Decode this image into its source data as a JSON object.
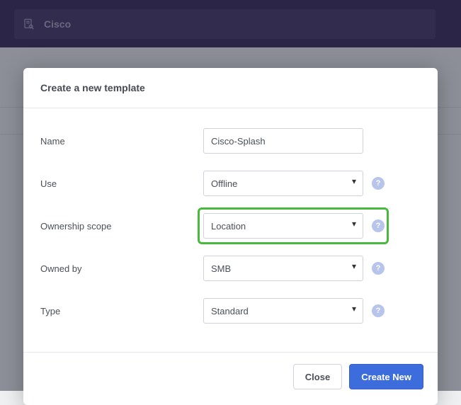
{
  "header": {
    "search_text": "Cisco"
  },
  "modal": {
    "title": "Create a new template",
    "fields": {
      "name": {
        "label": "Name",
        "value": "Cisco-Splash"
      },
      "use": {
        "label": "Use",
        "value": "Offline"
      },
      "ownership_scope": {
        "label": "Ownership scope",
        "value": "Location"
      },
      "owned_by": {
        "label": "Owned by",
        "value": "SMB"
      },
      "type": {
        "label": "Type",
        "value": "Standard"
      }
    },
    "help": {
      "glyph": "?"
    },
    "footer": {
      "close": "Close",
      "create": "Create New"
    }
  }
}
